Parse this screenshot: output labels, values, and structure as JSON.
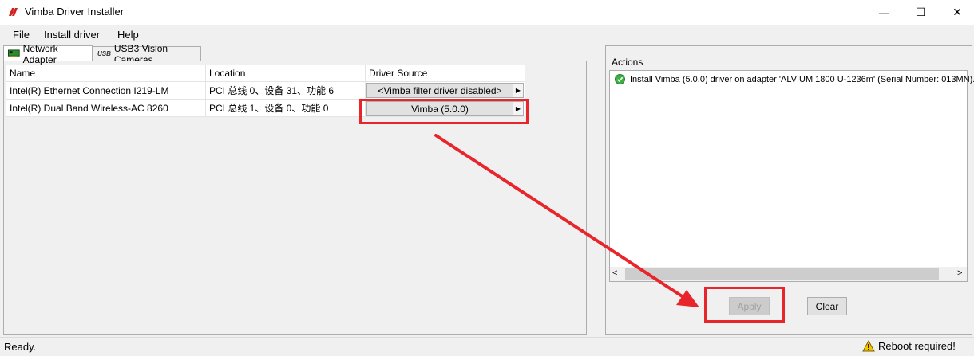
{
  "window": {
    "title": "Vimba Driver Installer",
    "minimize_glyph": "—",
    "maximize_glyph": "☐",
    "close_glyph": "✕"
  },
  "menu": [
    "File",
    "Install driver",
    "Help"
  ],
  "tabs": [
    {
      "label": "Network Adapter",
      "icon": "network-card-icon",
      "active": true
    },
    {
      "label": "USB3 Vision Cameras",
      "icon": "usb3-icon",
      "active": false
    }
  ],
  "usb3_icon_text": "USB",
  "table": {
    "headers": [
      "Name",
      "Location",
      "Driver Source"
    ],
    "rows": [
      {
        "name": "Intel(R) Ethernet Connection I219-LM",
        "location": "PCI 总线 0、设备 31、功能 6",
        "driver": "<Vimba filter driver disabled>"
      },
      {
        "name": "Intel(R) Dual Band Wireless-AC 8260",
        "location": "PCI 总线 1、设备 0、功能 0",
        "driver": "Vimba (5.0.0)"
      }
    ]
  },
  "actions": {
    "label": "Actions",
    "items": [
      "Install Vimba (5.0.0) driver on adapter 'ALVIUM 1800 U-1236m' (Serial Number: 013MN)."
    ],
    "scroll_left": "<",
    "scroll_right": ">"
  },
  "buttons": {
    "apply": "Apply",
    "clear": "Clear"
  },
  "status": {
    "left": "Ready.",
    "right": "Reboot required!"
  },
  "colors": {
    "annotation_red": "#e8252a",
    "ok_green": "#3cb043",
    "warning_yellow": "#f5c400"
  }
}
